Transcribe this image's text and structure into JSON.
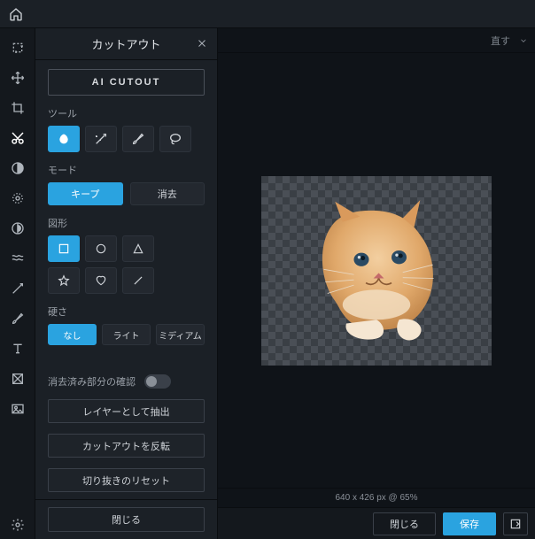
{
  "topbar": {},
  "panel": {
    "title": "カットアウト",
    "ai_cutout": "AI CUTOUT",
    "section_tool": "ツール",
    "section_mode": "モード",
    "mode_keep": "キープ",
    "mode_remove": "消去",
    "section_shape": "図形",
    "section_hardness": "硬さ",
    "hardness_none": "なし",
    "hardness_light": "ライト",
    "hardness_medium": "ミディアム",
    "toggle_erased_preview": "消去済み部分の確認",
    "action_extract_layer": "レイヤーとして抽出",
    "action_invert_cutout": "カットアウトを反転",
    "action_reset_crop": "切り抜きのリセット",
    "footer_close": "閉じる"
  },
  "canvas": {
    "redo_hint": "直す",
    "status": "640 x 426 px @ 65%"
  },
  "bottombar": {
    "close": "閉じる",
    "save": "保存"
  }
}
